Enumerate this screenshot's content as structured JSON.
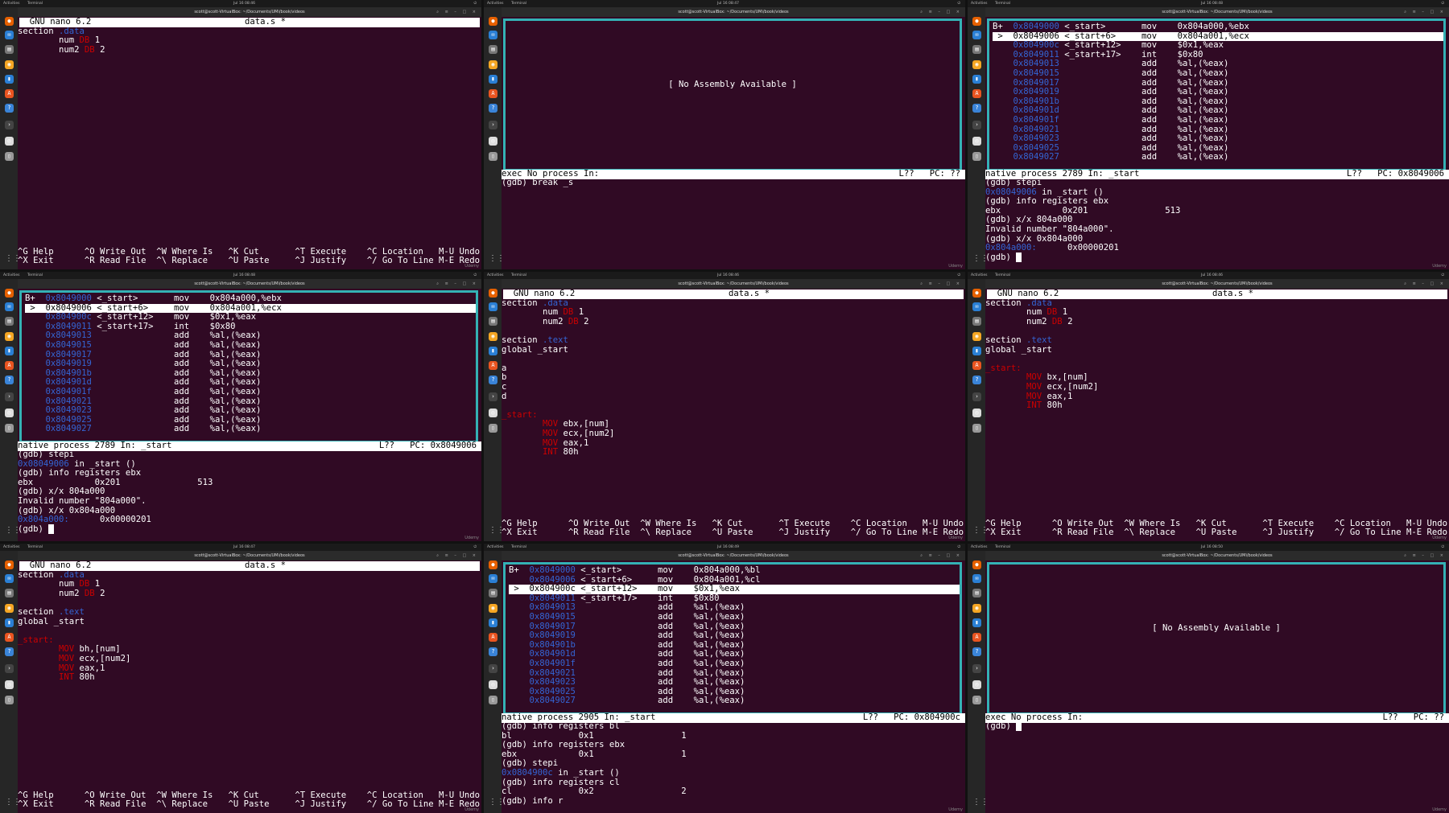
{
  "colors": {
    "terminal_bg": "#300a24",
    "tui_border": "#34b1b5",
    "address": "#3465d4",
    "keyword": "#cc0000"
  },
  "common": {
    "activities": "Activities",
    "app": "Terminal",
    "window_title": "scott@scott-VirtualBox: ~/Documents/UMi/book/videos",
    "nano_header": "  GNU nano 6.2",
    "nano_file": "data.s *",
    "nano_short1": "^G Help      ^O Write Out  ^W Where Is   ^K Cut       ^T Execute    ^C Location   M-U Undo",
    "nano_short2": "^X Exit      ^R Read File  ^\\ Replace    ^U Paste     ^J Justify    ^/ Go To Line M-E Redo",
    "no_asm": "[ No Assembly Available ]",
    "stamp": "Udemy"
  },
  "panels": [
    {
      "clock": "Jul 16 08:46",
      "lines": [
        "section .data",
        "        num DB 1",
        "        num2 DB 2"
      ]
    },
    {
      "clock": "Jul 16 08:47",
      "status_left": "exec No process In:",
      "status_right": "L??   PC: ??",
      "cmd": [
        "(gdb) break _s"
      ]
    },
    {
      "clock": "Jul 16 08:48",
      "status_left": "native process 2789 In: _start",
      "status_right": "L??   PC: 0x8049006",
      "asm": [
        "B+  0x8049000 <_start>       mov    0x804a000,%ebx",
        " >  0x8049006 <_start+6>     mov    0x804a001,%ecx",
        "    0x804900c <_start+12>    mov    $0x1,%eax",
        "    0x8049011 <_start+17>    int    $0x80",
        "    0x8049013                add    %al,(%eax)",
        "    0x8049015                add    %al,(%eax)",
        "    0x8049017                add    %al,(%eax)",
        "    0x8049019                add    %al,(%eax)",
        "    0x804901b                add    %al,(%eax)",
        "    0x804901d                add    %al,(%eax)",
        "    0x804901f                add    %al,(%eax)",
        "    0x8049021                add    %al,(%eax)",
        "    0x8049023                add    %al,(%eax)",
        "    0x8049025                add    %al,(%eax)",
        "    0x8049027                add    %al,(%eax)"
      ],
      "cmd": [
        "(gdb) stepi",
        "0x08049006 in _start ()",
        "(gdb) info registers ebx",
        "ebx            0x201               513",
        "(gdb) x/x 804a000",
        "Invalid number \"804a000\".",
        "(gdb) x/x 0x804a000",
        "0x804a000:      0x00000201",
        "(gdb) "
      ]
    },
    {
      "clock": "Jul 16 08:48",
      "status_left": "native process 2789 In: _start",
      "status_right": "L??   PC: 0x8049006",
      "asm": [
        "B+  0x8049000 <_start>       mov    0x804a000,%ebx",
        " >  0x8049006 <_start+6>     mov    0x804a001,%ecx",
        "    0x804900c <_start+12>    mov    $0x1,%eax",
        "    0x8049011 <_start+17>    int    $0x80",
        "    0x8049013                add    %al,(%eax)",
        "    0x8049015                add    %al,(%eax)",
        "    0x8049017                add    %al,(%eax)",
        "    0x8049019                add    %al,(%eax)",
        "    0x804901b                add    %al,(%eax)",
        "    0x804901d                add    %al,(%eax)",
        "    0x804901f                add    %al,(%eax)",
        "    0x8049021                add    %al,(%eax)",
        "    0x8049023                add    %al,(%eax)",
        "    0x8049025                add    %al,(%eax)",
        "    0x8049027                add    %al,(%eax)"
      ],
      "cmd": [
        "(gdb) stepi",
        "0x08049006 in _start ()",
        "(gdb) info registers ebx",
        "ebx            0x201               513",
        "(gdb) x/x 804a000",
        "Invalid number \"804a000\".",
        "(gdb) x/x 0x804a000",
        "0x804a000:      0x00000201",
        "(gdb) "
      ]
    },
    {
      "clock": "Jul 16 08:46",
      "lines": [
        "section .data",
        "        num DB 1",
        "        num2 DB 2",
        "",
        "section .text",
        "global _start",
        "",
        "a",
        "b",
        "c",
        "d",
        "",
        "_start:",
        "        MOV ebx,[num]",
        "        MOV ecx,[num2]",
        "        MOV eax,1",
        "        INT 80h"
      ]
    },
    {
      "clock": "Jul 16 08:46",
      "lines": [
        "section .data",
        "        num DB 1",
        "        num2 DB 2",
        "",
        "section .text",
        "global _start",
        "",
        "_start:",
        "        MOV bx,[num]",
        "        MOV ecx,[num2]",
        "        MOV eax,1",
        "        INT 80h"
      ]
    },
    {
      "clock": "Jul 16 08:47",
      "lines": [
        "section .data",
        "        num DB 1",
        "        num2 DB 2",
        "",
        "section .text",
        "global _start",
        "",
        "_start:",
        "        MOV bh,[num]",
        "        MOV ecx,[num2]",
        "        MOV eax,1",
        "        INT 80h"
      ]
    },
    {
      "clock": "Jul 16 08:49",
      "status_left": "native process 2905 In: _start",
      "status_right": "L??   PC: 0x804900c",
      "asm": [
        "B+  0x8049000 <_start>       mov    0x804a000,%bl",
        "    0x8049006 <_start+6>     mov    0x804a001,%cl",
        " >  0x804900c <_start+12>    mov    $0x1,%eax",
        "    0x8049011 <_start+17>    int    $0x80",
        "    0x8049013                add    %al,(%eax)",
        "    0x8049015                add    %al,(%eax)",
        "    0x8049017                add    %al,(%eax)",
        "    0x8049019                add    %al,(%eax)",
        "    0x804901b                add    %al,(%eax)",
        "    0x804901d                add    %al,(%eax)",
        "    0x804901f                add    %al,(%eax)",
        "    0x8049021                add    %al,(%eax)",
        "    0x8049023                add    %al,(%eax)",
        "    0x8049025                add    %al,(%eax)",
        "    0x8049027                add    %al,(%eax)"
      ],
      "cmd": [
        "(gdb) info registers bl",
        "bl             0x1                 1",
        "(gdb) info registers ebx",
        "ebx            0x1                 1",
        "(gdb) stepi",
        "0x0804900c in _start ()",
        "(gdb) info registers cl",
        "cl             0x2                 2",
        "(gdb) info r"
      ]
    },
    {
      "clock": "Jul 16 08:50",
      "status_left": "exec No process In:",
      "status_right": "L??   PC: ??",
      "cmd": [
        "(gdb) "
      ]
    }
  ]
}
